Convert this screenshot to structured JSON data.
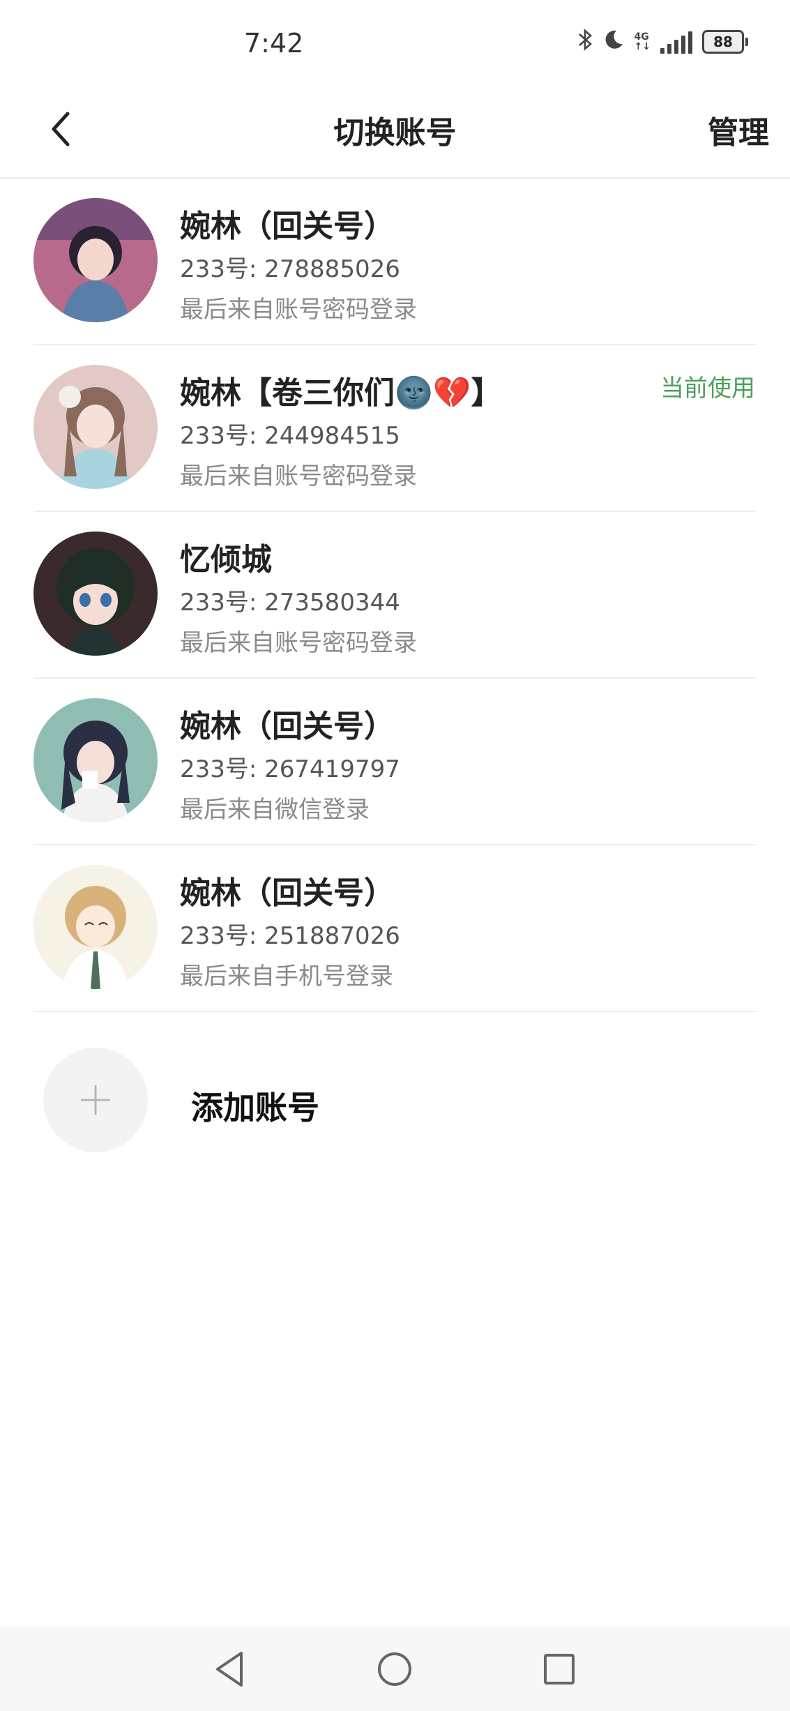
{
  "status_bar": {
    "time": "7:42",
    "icons": [
      "bluetooth-icon",
      "moon-icon",
      "signal-icon"
    ],
    "network": [
      "4G",
      "↑↓"
    ],
    "battery": "88"
  },
  "header": {
    "title": "切换账号",
    "manage": "管理"
  },
  "accounts": [
    {
      "name": "婉林（回关号）",
      "uid": "233号: 278885026",
      "login": "最后来自账号密码登录",
      "current": ""
    },
    {
      "name": "婉林【卷三你们🌚💔】",
      "uid": "233号: 244984515",
      "login": "最后来自账号密码登录",
      "current": "当前使用"
    },
    {
      "name": "忆倾城",
      "uid": "233号: 273580344",
      "login": "最后来自账号密码登录",
      "current": ""
    },
    {
      "name": "婉林（回关号）",
      "uid": "233号: 267419797",
      "login": "最后来自微信登录",
      "current": ""
    },
    {
      "name": "婉林（回关号）",
      "uid": "233号: 251887026",
      "login": "最后来自手机号登录",
      "current": ""
    }
  ],
  "add_account": {
    "label": "添加账号"
  },
  "colors": {
    "accent_green": "#4aa05a",
    "divider": "#efefef"
  }
}
